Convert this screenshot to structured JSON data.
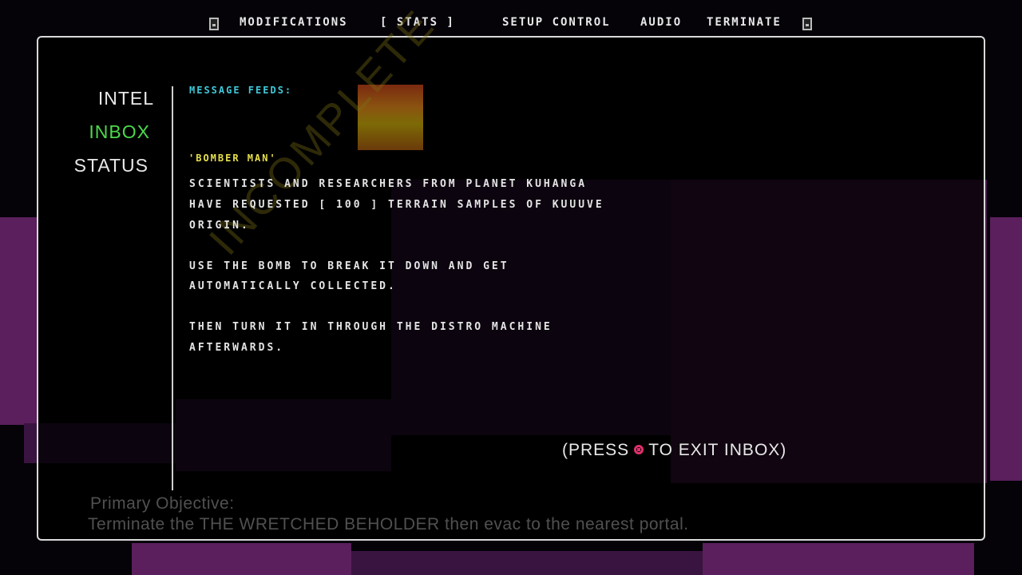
{
  "top_menu": {
    "items": [
      {
        "label": "MODIFICATIONS"
      },
      {
        "label": "[ STATS ]"
      },
      {
        "label": "SETUP CONTROL"
      },
      {
        "label": "AUDIO"
      },
      {
        "label": "TERMINATE"
      }
    ]
  },
  "side_tabs": {
    "intel": "INTEL",
    "inbox": "INBOX",
    "status": "STATUS",
    "active": "INBOX"
  },
  "inbox": {
    "feeds_label": "MESSAGE FEEDS:",
    "stamp": "INCOMPLETE",
    "message_title": "'BOMBER MAN'",
    "message_lines": [
      "SCIENTISTS AND RESEARCHERS FROM PLANET KUHANGA",
      "HAVE REQUESTED [ 100 ] TERRAIN SAMPLES OF KUUUVE",
      "ORIGIN.",
      "",
      "USE THE BOMB TO BREAK IT DOWN AND GET",
      "AUTOMATICALLY COLLECTED.",
      "",
      "THEN TURN IT IN THROUGH THE DISTRO MACHINE",
      "AFTERWARDS."
    ]
  },
  "exit_hint": {
    "before": "(PRESS",
    "after": "TO EXIT INBOX)"
  },
  "objective": {
    "label": "Primary Objective:",
    "text": "Terminate the THE WRETCHED BEHOLDER then evac to the nearest portal."
  },
  "colors": {
    "active_tab": "#4bd84b",
    "feeds_label": "#40c8d8",
    "message_title": "#e6e04a",
    "exit_button": "#e0306a",
    "scenery_purple": "#5a1f5c"
  },
  "icons": {
    "left_bumper": "left-bumper-icon",
    "right_bumper": "right-bumper-icon",
    "exit_button": "circle-button-icon"
  }
}
